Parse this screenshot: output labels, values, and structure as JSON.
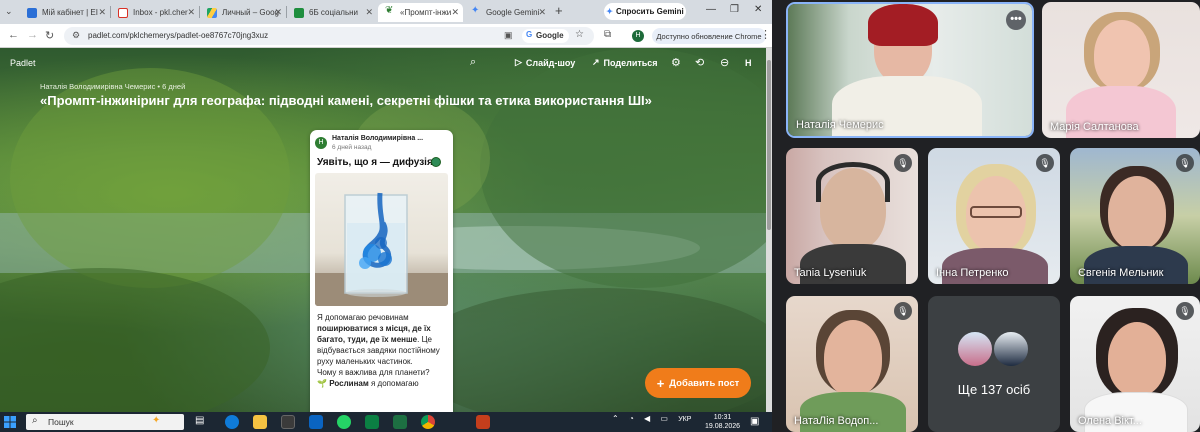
{
  "browser": {
    "tabs": [
      {
        "label": "Мій кабінет | EI"
      },
      {
        "label": "Inbox - pkl.cher"
      },
      {
        "label": "Личный – Goog"
      },
      {
        "label": "6Б соціальни"
      },
      {
        "label": "«Промпт-інжи"
      },
      {
        "label": "Google Gemini"
      }
    ],
    "new_tab_label": "+",
    "gemini_button": "Спросить Gemini",
    "url": "padlet.com/pklchemerys/padlet-oe8767c70jng3xuz",
    "google_chip": "Google",
    "update_button": "Доступно обновление Chrome",
    "profile_letter": "H"
  },
  "padlet": {
    "logo": "Padlet",
    "slideshow_label": "Слайд-шоу",
    "share_label": "Поделиться",
    "profile_letter": "H",
    "author_line": "Наталія Володимирівна Чемерис • 6 дней",
    "title": "«Промпт-інжиніринг для географа: підводні камені, секретні фішки та етика використання ШІ»",
    "card": {
      "avatar_letter": "H",
      "author": "Наталія Володимирівна ...",
      "time": "6 дней назад",
      "title": "Уявіть, що я — дифузія!",
      "text_1": "Я допомагаю речовинам ",
      "text_2": "поширюватися з місця, де їх багато, туди, де їх менше",
      "text_3": ". Це відбувається завдяки постійному руху маленьких частинок.",
      "text_4": "Чому я важлива для планети?",
      "text_5": "Рослинам",
      "text_6": " я допомагаю"
    },
    "add_post_label": "Добавить пост"
  },
  "taskbar": {
    "search_label": "Пошук",
    "language": "УКР",
    "time": "10:31",
    "date": "19.08.2026"
  },
  "meet": {
    "participants": [
      {
        "name": "Наталія Чемерис"
      },
      {
        "name": "Марія Салтанова"
      },
      {
        "name": "Tania Lyseniuk"
      },
      {
        "name": "Інна Петренко"
      },
      {
        "name": "Євгенія Мельник"
      },
      {
        "name": "НатаЛія Водоп..."
      },
      {
        "name": "Ще 137 осіб"
      },
      {
        "name": "Олена Вікт..."
      }
    ]
  }
}
